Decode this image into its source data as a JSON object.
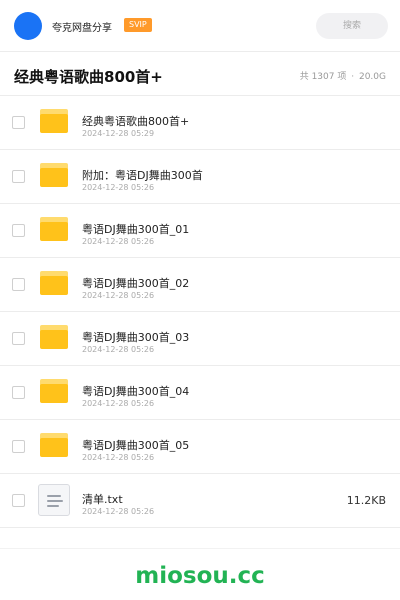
{
  "header": {
    "user_name": "夸克网盘分享",
    "badge": "SVIP",
    "search_placeholder": "搜索"
  },
  "folder": {
    "title": "经典粤语歌曲800首+",
    "count_text": "共 1307 项",
    "separator": "·",
    "total_size": "20.0G"
  },
  "files": [
    {
      "name": "经典粤语歌曲800首+",
      "date": "2024-12-28 05:29",
      "type": "folder",
      "size": ""
    },
    {
      "name": "附加：粤语DJ舞曲300首",
      "date": "2024-12-28 05:26",
      "type": "folder",
      "size": ""
    },
    {
      "name": "粤语DJ舞曲300首_01",
      "date": "2024-12-28 05:26",
      "type": "folder",
      "size": ""
    },
    {
      "name": "粤语DJ舞曲300首_02",
      "date": "2024-12-28 05:26",
      "type": "folder",
      "size": ""
    },
    {
      "name": "粤语DJ舞曲300首_03",
      "date": "2024-12-28 05:26",
      "type": "folder",
      "size": ""
    },
    {
      "name": "粤语DJ舞曲300首_04",
      "date": "2024-12-28 05:26",
      "type": "folder",
      "size": ""
    },
    {
      "name": "粤语DJ舞曲300首_05",
      "date": "2024-12-28 05:26",
      "type": "folder",
      "size": ""
    },
    {
      "name": "清单.txt",
      "date": "2024-12-28 05:26",
      "type": "document",
      "size": "11.2KB"
    }
  ],
  "icons": {
    "avatar": "avatar-circle",
    "folder": "folder-icon",
    "document": "text-document-icon",
    "checkbox": "checkbox-unchecked"
  },
  "colors": {
    "avatar": "#1a73f5",
    "badge": "#ff9a2a",
    "folder": "#ffc21a",
    "watermark": "#22b354"
  },
  "watermark": "miosou.cc"
}
